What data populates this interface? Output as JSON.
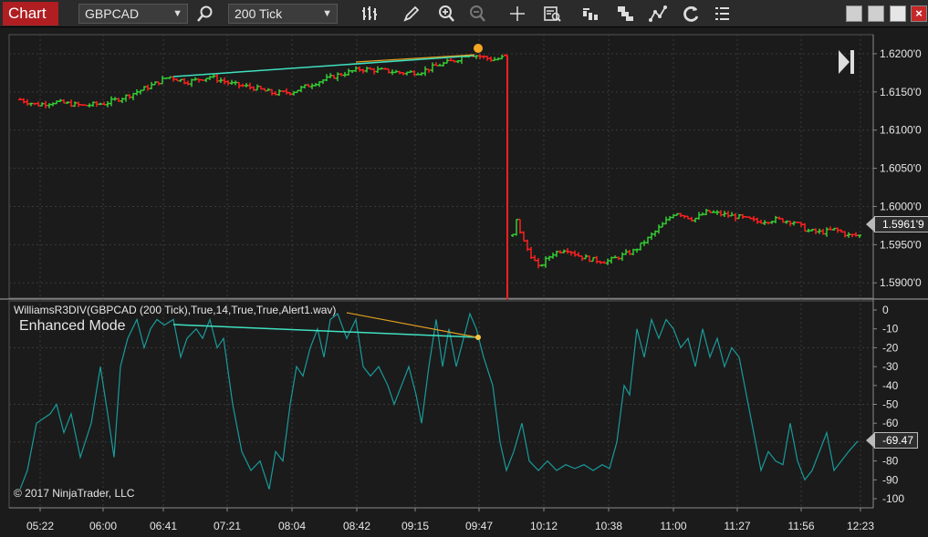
{
  "toolbar": {
    "tab_label": "Chart",
    "instrument": "GBPCAD",
    "interval": "200 Tick",
    "icons": [
      "search-icon",
      "bar-type-icon",
      "draw-pencil-icon",
      "zoom-in-icon",
      "zoom-out-icon",
      "crosshair-icon",
      "data-box-icon",
      "chart-properties-icon",
      "strategies-icon",
      "drawing-tools-icon",
      "refresh-icon",
      "templates-icon"
    ]
  },
  "price_panel": {
    "last_price": "1.5961'9",
    "y_ticks": [
      "1.6200'0",
      "1.6150'0",
      "1.6100'0",
      "1.6050'0",
      "1.6000'0",
      "1.5950'0",
      "1.5900'0"
    ]
  },
  "indicator_panel": {
    "label": "WilliamsR3DIV(GBPCAD (200 Tick),True,14,True,True,Alert1.wav)",
    "mode": "Enhanced Mode",
    "last_value": "-69.47",
    "y_ticks": [
      "0",
      "-10",
      "-20",
      "-30",
      "-40",
      "-50",
      "-60",
      "-70",
      "-80",
      "-90",
      "-100"
    ]
  },
  "x_ticks": [
    "05:22",
    "06:00",
    "06:41",
    "07:21",
    "08:04",
    "08:42",
    "09:15",
    "09:47",
    "10:12",
    "10:38",
    "11:00",
    "11:27",
    "11:56",
    "12:23"
  ],
  "copyright": "© 2017 NinjaTrader, LLC",
  "colors": {
    "up": "#33cc33",
    "down": "#ff2020",
    "divergence": "#40e0c0",
    "divergence_price": "#e0a020",
    "williams_line": "#1a9a9a",
    "tab": "#b01e22"
  },
  "chart_data": [
    {
      "type": "line",
      "title": "GBPCAD (200 Tick)",
      "series": [
        {
          "name": "",
          "x": [
            "05:22",
            "06:00",
            "06:41",
            "07:21",
            "08:04",
            "08:42",
            "09:15",
            "09:47",
            "09:55",
            "10:12",
            "10:38",
            "11:00",
            "11:27",
            "11:56",
            "12:23"
          ],
          "values": [
            1.614,
            1.6135,
            1.6165,
            1.6155,
            1.6145,
            1.618,
            1.618,
            1.62,
            1.588,
            1.5925,
            1.592,
            1.5995,
            1.599,
            1.5975,
            1.5962
          ]
        }
      ],
      "ylim": [
        1.588,
        1.6225
      ]
    },
    {
      "type": "line",
      "title": "WilliamsR3DIV(GBPCAD (200 Tick),True,14,True,True,Alert1.wav)",
      "series": [
        {
          "name": "",
          "x": [
            "05:22",
            "06:00",
            "06:41",
            "07:21",
            "08:04",
            "08:42",
            "09:15",
            "09:47",
            "10:12",
            "10:38",
            "11:00",
            "11:27",
            "11:56",
            "12:23"
          ],
          "values": [
            -95,
            -60,
            -5,
            -30,
            -75,
            -30,
            -45,
            -8,
            -85,
            -85,
            -40,
            -20,
            -80,
            -69.47
          ]
        }
      ],
      "ylim": [
        -100,
        0
      ]
    }
  ]
}
